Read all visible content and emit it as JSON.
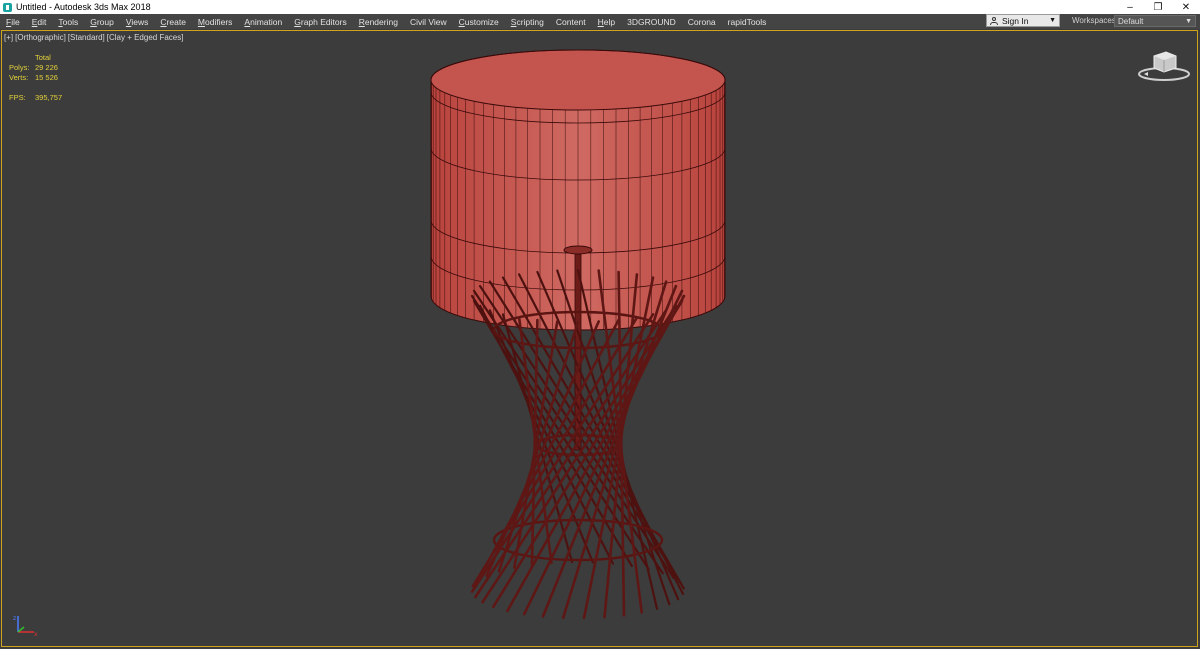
{
  "window": {
    "title": "Untitled - Autodesk 3ds Max 2018",
    "minimize": "–",
    "restore": "❐",
    "close": "✕"
  },
  "menu": [
    {
      "label": "File",
      "u": "F",
      "rest": "ile"
    },
    {
      "label": "Edit",
      "u": "E",
      "rest": "dit"
    },
    {
      "label": "Tools",
      "u": "T",
      "rest": "ools"
    },
    {
      "label": "Group",
      "u": "G",
      "rest": "roup"
    },
    {
      "label": "Views",
      "u": "V",
      "rest": "iews"
    },
    {
      "label": "Create",
      "u": "C",
      "rest": "reate"
    },
    {
      "label": "Modifiers",
      "u": "M",
      "rest": "odifiers"
    },
    {
      "label": "Animation",
      "u": "A",
      "rest": "nimation"
    },
    {
      "label": "Graph Editors",
      "u": "G",
      "rest": "raph Editors"
    },
    {
      "label": "Rendering",
      "u": "R",
      "rest": "endering"
    },
    {
      "label": "Civil View",
      "u": "",
      "rest": "Civil View"
    },
    {
      "label": "Customize",
      "u": "C",
      "rest": "ustomize"
    },
    {
      "label": "Scripting",
      "u": "S",
      "rest": "cripting"
    },
    {
      "label": "Content",
      "u": "",
      "rest": "Content"
    },
    {
      "label": "Help",
      "u": "H",
      "rest": "elp"
    },
    {
      "label": "3DGROUND",
      "u": "",
      "rest": "3DGROUND"
    },
    {
      "label": "Corona",
      "u": "",
      "rest": "Corona"
    },
    {
      "label": "rapidTools",
      "u": "",
      "rest": "rapidTools"
    }
  ],
  "signin": {
    "label": "Sign In",
    "icon": "user-icon"
  },
  "workspaces": {
    "label": "Workspaces:",
    "value": "Default"
  },
  "viewport": {
    "label_parts": [
      "[+]",
      "[Orthographic]",
      "[Standard]",
      "[Clay + Edged Faces]"
    ],
    "stats": {
      "total": "Total",
      "polys_label": "Polys:",
      "polys": "29 226",
      "verts_label": "Verts:",
      "verts": "15 526",
      "fps_label": "FPS:",
      "fps": "395,757"
    }
  },
  "colors": {
    "shade": "#c25049",
    "wire": "#3a0a0a",
    "border": "#cfa51f",
    "stats": "#e4d23a"
  }
}
